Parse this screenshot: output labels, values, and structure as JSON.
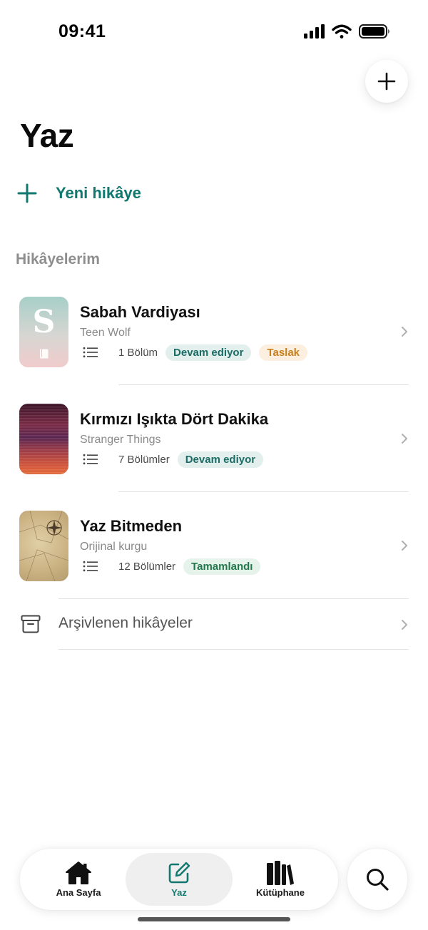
{
  "status_bar": {
    "time": "09:41"
  },
  "header": {
    "title": "Yaz"
  },
  "new_story": {
    "label": "Yeni hikâye"
  },
  "section": {
    "title": "Hikâyelerim"
  },
  "stories": [
    {
      "title": "Sabah Vardiyası",
      "fandom": "Teen Wolf",
      "chapters": "1 Bölüm",
      "badges": [
        {
          "label": "Devam ediyor",
          "kind": "ongoing"
        },
        {
          "label": "Taslak",
          "kind": "draft"
        }
      ],
      "cover_letter": "S"
    },
    {
      "title": "Kırmızı Işıkta Dört Dakika",
      "fandom": "Stranger Things",
      "chapters": "7 Bölümler",
      "badges": [
        {
          "label": "Devam ediyor",
          "kind": "ongoing"
        }
      ]
    },
    {
      "title": "Yaz Bitmeden",
      "fandom": "Orijinal kurgu",
      "chapters": "12 Bölümler",
      "badges": [
        {
          "label": "Tamamlandı",
          "kind": "done"
        }
      ]
    }
  ],
  "archive": {
    "label": "Arşivlenen hikâyeler"
  },
  "tabbar": {
    "tabs": [
      {
        "label": "Ana Sayfa",
        "icon": "home-icon",
        "active": false
      },
      {
        "label": "Yaz",
        "icon": "compose-icon",
        "active": true
      },
      {
        "label": "Kütüphane",
        "icon": "library-icon",
        "active": false
      }
    ]
  },
  "colors": {
    "accent": "#11786f",
    "ongoing_badge": "#e3efec",
    "draft_badge": "#fcefdf",
    "done_badge": "#e5f3eb"
  }
}
